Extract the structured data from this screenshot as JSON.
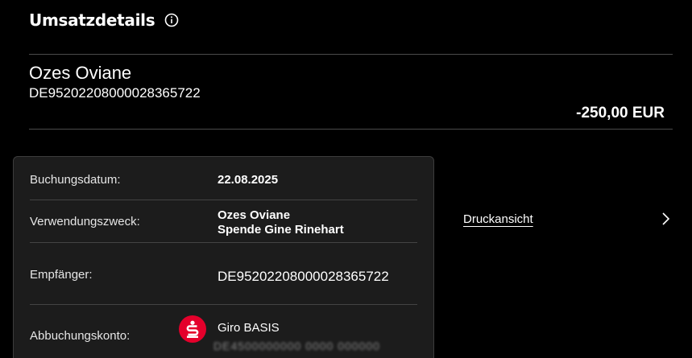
{
  "header": {
    "title": "Umsatzdetails",
    "info_icon": "info-icon"
  },
  "transaction": {
    "counterparty_name": "Ozes Oviane",
    "counterparty_iban": "DE95202208000028365722",
    "amount": "-250,00 EUR"
  },
  "details": {
    "booking_date_label": "Buchungsdatum:",
    "booking_date_value": "22.08.2025",
    "purpose_label": "Verwendungszweck:",
    "purpose_line1": "Ozes Oviane",
    "purpose_line2": "Spende Gine Rinehart",
    "recipient_label": "Empfänger:",
    "recipient_value": "DE95202208000028365722",
    "debit_account_label": "Abbuchungskonto:",
    "debit_account_name": "Giro BASIS",
    "debit_account_iban_masked": "DE4500000000 0000 000000",
    "bank_logo_icon": "sparkasse-logo-icon"
  },
  "actions": {
    "print_view_label": "Druckansicht",
    "chevron_icon": "chevron-right-icon"
  },
  "colors": {
    "background": "#000000",
    "card": "#1c1c1c",
    "divider": "#4a4a4a",
    "brand_red": "#e4002b"
  }
}
